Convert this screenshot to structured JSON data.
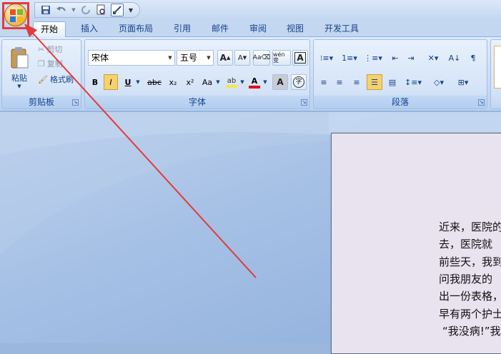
{
  "tabs": [
    "开始",
    "插入",
    "页面布局",
    "引用",
    "邮件",
    "审阅",
    "视图",
    "开发工具"
  ],
  "clipboard": {
    "paste": "粘贴",
    "cut": "剪切",
    "copy": "复制",
    "format_painter": "格式刷",
    "label": "剪贴板"
  },
  "font": {
    "name": "宋体",
    "size": "五号",
    "label": "字体",
    "bold": "B",
    "italic": "I",
    "underline": "U",
    "strike": "abc",
    "sub": "x₂",
    "sup": "x²",
    "case": "Aa",
    "wen": "wén 变",
    "A_big": "A",
    "A_small": "A"
  },
  "paragraph": {
    "label": "段落"
  },
  "document_lines": [
    "近来，医院的",
    "去，医院就",
    "前些天，我到",
    "问我朋友的",
    "出一份表格，",
    "早有两个护士",
    "“我没病!”我"
  ],
  "colors": {
    "accent": "#15428b",
    "arrow": "#e53a3a",
    "highlight": "#f5e64a",
    "font_red": "#e01010"
  }
}
